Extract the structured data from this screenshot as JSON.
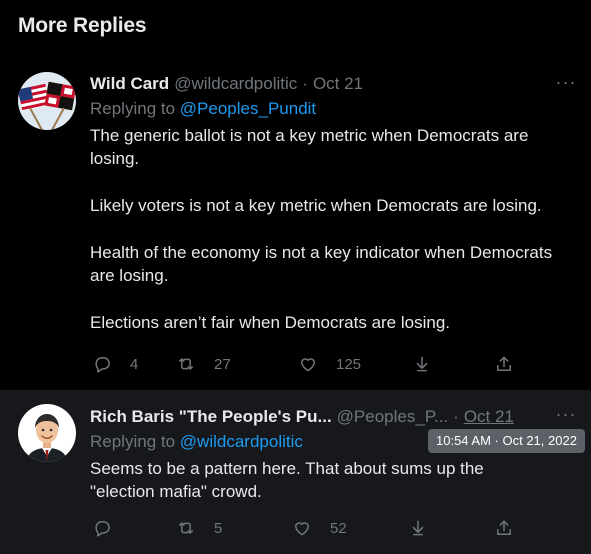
{
  "section": {
    "title": "More Replies"
  },
  "tweets": [
    {
      "name": "Wild Card",
      "handle": "@wildcardpolitic",
      "separator": "·",
      "date": "Oct 21",
      "replying_prefix": "Replying to",
      "replying_to": "@Peoples_Pundit",
      "paragraphs": [
        "The generic ballot is not a key metric when Democrats are losing.",
        "Likely voters is not a key metric when Democrats are losing.",
        "Health of the economy is not a key indicator when Democrats are losing.",
        "Elections aren’t fair when Democrats are losing."
      ],
      "reply_count": "4",
      "retweet_count": "27",
      "like_count": "125"
    },
    {
      "name": "Rich Baris \"The People's Pu...",
      "handle": "@Peoples_P...",
      "separator": "·",
      "date": "Oct 21",
      "replying_prefix": "Replying to",
      "replying_to": "@wildcardpolitic",
      "paragraphs": [
        "Seems to be a pattern here. That about sums up the \"election mafia\" crowd."
      ],
      "reply_count": "",
      "retweet_count": "5",
      "like_count": "52"
    }
  ],
  "tooltip": {
    "text": "10:54 AM · Oct 21, 2022"
  },
  "icons": {
    "more": "more-horizontal-icon",
    "reply": "reply-icon",
    "retweet": "retweet-icon",
    "like": "heart-icon",
    "bookmark": "bookmark-icon",
    "share": "share-icon"
  },
  "colors": {
    "background": "#000000",
    "hover_background": "#16181c",
    "text": "#e7e9ea",
    "muted": "#71767b",
    "accent": "#1d9bf0",
    "tooltip": "#5b6166"
  }
}
